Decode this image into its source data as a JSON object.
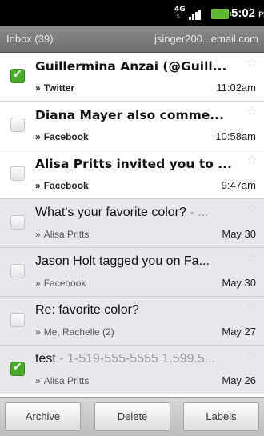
{
  "status_bar": {
    "network": "4G",
    "time": "5:02",
    "ampm": "PM"
  },
  "header": {
    "folder": "Inbox (39)",
    "account": "jsinger200...email.com"
  },
  "messages": [
    {
      "subject": "Guillermina Anzai (@Guill...",
      "snippet": "",
      "sender": "Twitter",
      "date": "11:02am",
      "unread": true,
      "checked": true
    },
    {
      "subject": "Diana Mayer also comme...",
      "snippet": "",
      "sender": "Facebook",
      "date": "10:58am",
      "unread": true,
      "checked": false
    },
    {
      "subject": "Alisa Pritts invited you to ...",
      "snippet": "",
      "sender": "Facebook",
      "date": "9:47am",
      "unread": true,
      "checked": false
    },
    {
      "subject": "What's your favorite color?",
      "snippet": " - ...",
      "sender": "Alisa Pritts",
      "date": "May 30",
      "unread": false,
      "checked": false
    },
    {
      "subject": "Jason Holt tagged you on Fa...",
      "snippet": "",
      "sender": "Facebook",
      "date": "May 30",
      "unread": false,
      "checked": false
    },
    {
      "subject": "Re: favorite color?",
      "snippet": "",
      "sender": "Me, Rachelle (2)",
      "date": "May 27",
      "unread": false,
      "checked": false
    },
    {
      "subject": "test",
      "snippet": " - 1-519-555-5555 1.599.5...",
      "sender": "Alisa Pritts",
      "date": "May 26",
      "unread": false,
      "checked": true
    }
  ],
  "actions": {
    "archive": "Archive",
    "delete": "Delete",
    "labels": "Labels"
  },
  "colors": {
    "check_green": "#4aa82a",
    "header_gray": "#7d7d7d",
    "read_row_bg": "#e9e7ec"
  }
}
